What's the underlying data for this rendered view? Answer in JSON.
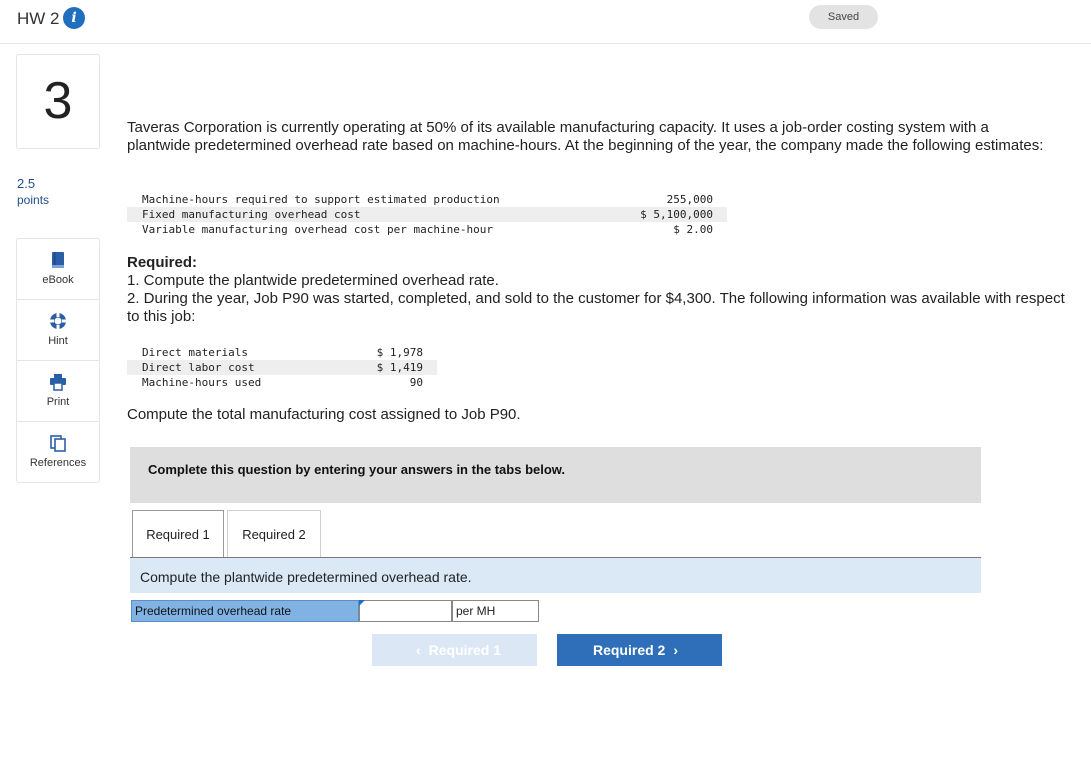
{
  "header": {
    "title": "HW 2",
    "info_icon": "info-icon",
    "saved_label": "Saved"
  },
  "sidebar": {
    "question_number": "3",
    "points_value": "2.5",
    "points_label": "points",
    "tools": [
      {
        "label": "eBook",
        "icon": "book-icon"
      },
      {
        "label": "Hint",
        "icon": "hint-icon"
      },
      {
        "label": "Print",
        "icon": "print-icon"
      },
      {
        "label": "References",
        "icon": "references-icon"
      }
    ]
  },
  "question": {
    "intro": "Taveras Corporation is currently operating at 50% of its available manufacturing capacity. It uses a job-order costing system with a plantwide predetermined overhead rate based on machine-hours. At the beginning of the year, the company made the following estimates:",
    "estimates": [
      {
        "label": "Machine-hours required to support estimated production",
        "value": "255,000"
      },
      {
        "label": "Fixed manufacturing overhead cost",
        "value": "$ 5,100,000"
      },
      {
        "label": "Variable manufacturing overhead cost per machine-hour",
        "value": "$ 2.00"
      }
    ],
    "required_heading": "Required:",
    "required_1": "1. Compute the plantwide predetermined overhead rate.",
    "required_2": "2. During the year, Job P90 was started, completed, and sold to the customer for $4,300. The following information was available with respect to this job:",
    "job_info": [
      {
        "label": "Direct materials",
        "value": "$ 1,978"
      },
      {
        "label": "Direct labor cost",
        "value": "$ 1,419"
      },
      {
        "label": "Machine-hours used",
        "value": "90"
      }
    ],
    "compute_total": "Compute the total manufacturing cost assigned to Job P90."
  },
  "answer_panel": {
    "instruction": "Complete this question by entering your answers in the tabs below.",
    "tabs": [
      {
        "label": "Required 1",
        "active": true
      },
      {
        "label": "Required 2",
        "active": false
      }
    ],
    "prompt": "Compute the plantwide predetermined overhead rate.",
    "field_label": "Predetermined overhead rate",
    "field_value": "",
    "field_unit": "per MH",
    "prev_button": "Required 1",
    "next_button": "Required 2"
  },
  "colors": {
    "accent": "#2f6fba",
    "field_label_bg": "#80b3e3",
    "prompt_bg": "#dbe9f7",
    "instruction_bg": "#dedede"
  }
}
